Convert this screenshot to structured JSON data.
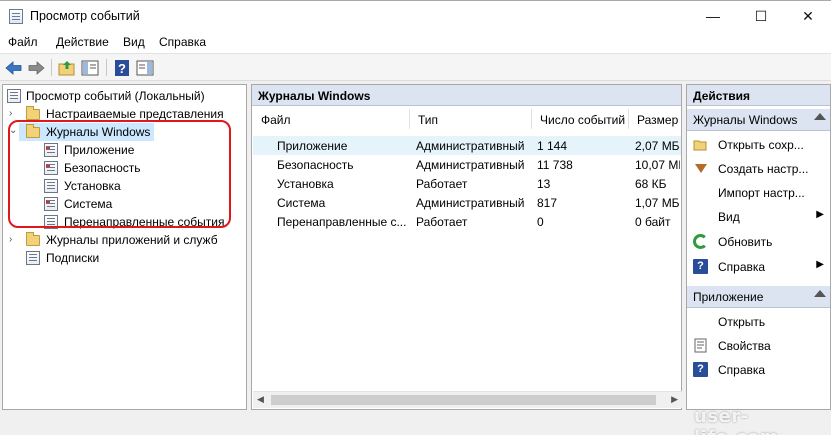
{
  "window": {
    "title": "Просмотр событий",
    "minimize_glyph": "—",
    "maximize_glyph": "☐",
    "close_glyph": "✕"
  },
  "menu": [
    "Файл",
    "Действие",
    "Вид",
    "Справка"
  ],
  "tree": {
    "root": "Просмотр событий (Локальный)",
    "custom_views": "Настраиваемые представления",
    "windows_logs": "Журналы Windows",
    "windows_children": [
      "Приложение",
      "Безопасность",
      "Установка",
      "Система",
      "Перенаправленные события"
    ],
    "app_services_logs": "Журналы приложений и служб",
    "subscriptions": "Подписки"
  },
  "center": {
    "header": "Журналы Windows",
    "columns": [
      "Файл",
      "Тип",
      "Число событий",
      "Размер"
    ],
    "rows": [
      [
        "Приложение",
        "Административный",
        "1 144",
        "2,07 МБ"
      ],
      [
        "Безопасность",
        "Административный",
        "11 738",
        "10,07 МБ"
      ],
      [
        "Установка",
        "Работает",
        "13",
        "68 КБ"
      ],
      [
        "Система",
        "Административный",
        "817",
        "1,07 МБ"
      ],
      [
        "Перенаправленные с...",
        "Работает",
        "0",
        "0 байт"
      ]
    ]
  },
  "actions": {
    "header": "Действия",
    "section1": "Журналы Windows",
    "items1": [
      "Открыть сохр...",
      "Создать настр...",
      "Импорт настр...",
      "Вид",
      "Обновить",
      "Справка"
    ],
    "section2": "Приложение",
    "items2": [
      "Открыть",
      "Свойства",
      "Справка"
    ]
  },
  "watermark": "user-life.com",
  "colors": {
    "highlight": "#e2171c",
    "panel_header": "#dbe4f0",
    "selection": "#cce8ff"
  }
}
